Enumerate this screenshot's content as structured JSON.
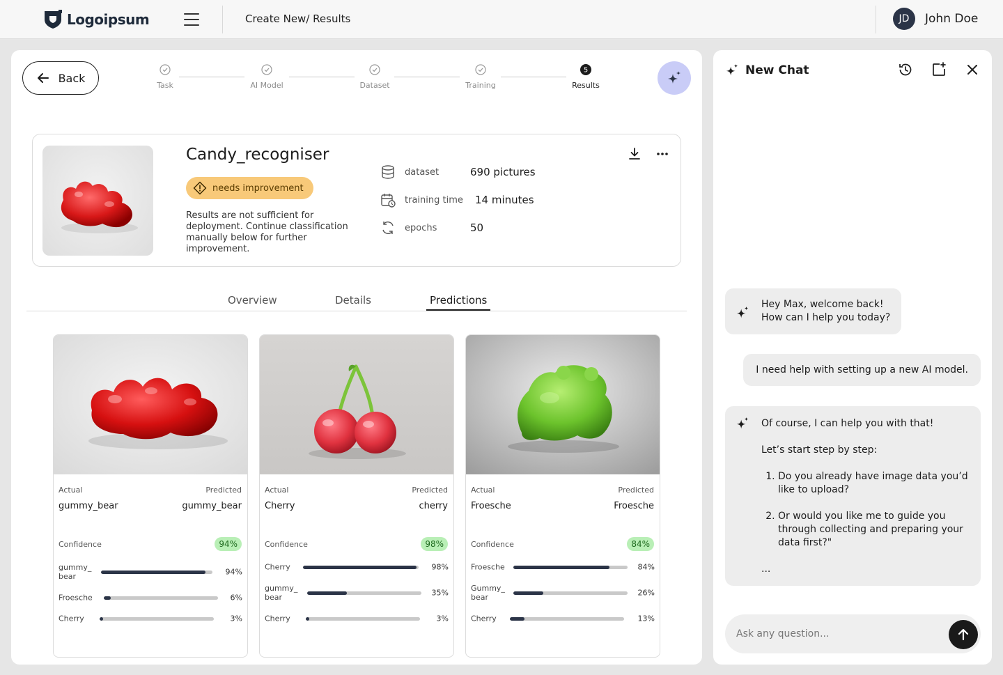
{
  "header": {
    "logo_text": "Logoipsum",
    "breadcrumb": "Create New/ Results",
    "user_initials": "JD",
    "user_name": "John Doe"
  },
  "back_label": "Back",
  "steps": [
    {
      "label": "Task",
      "state": "done"
    },
    {
      "label": "AI Model",
      "state": "done"
    },
    {
      "label": "Dataset",
      "state": "done"
    },
    {
      "label": "Training",
      "state": "done"
    },
    {
      "label": "Results",
      "state": "active",
      "number": "5"
    }
  ],
  "model": {
    "title": "Candy_recogniser",
    "badge": "needs improvement",
    "description": "Results are not sufficient for deployment. Continue classification manually below for further improvement.",
    "meta": [
      {
        "icon": "database-icon",
        "label": "dataset",
        "value": "690 pictures"
      },
      {
        "icon": "calendar-clock-icon",
        "label": "training time",
        "value": "14 minutes"
      },
      {
        "icon": "refresh-cycle-icon",
        "label": "epochs",
        "value": "50"
      }
    ]
  },
  "tabs": [
    "Overview",
    "Details",
    "Predictions"
  ],
  "active_tab": "Predictions",
  "labels": {
    "actual": "Actual",
    "predicted": "Predicted",
    "confidence": "Confidence"
  },
  "predictions": [
    {
      "image": "red gummy bear",
      "actual": "gummy_bear",
      "predicted": "gummy_bear",
      "confidence": "94%",
      "bars": [
        {
          "name": "gummy_ bear",
          "pct": 94,
          "label": "94%"
        },
        {
          "name": "Froesche",
          "pct": 6,
          "label": "6%"
        },
        {
          "name": "Cherry",
          "pct": 3,
          "label": "3%"
        }
      ]
    },
    {
      "image": "sugared cherries",
      "actual": "Cherry",
      "predicted": "cherry",
      "confidence": "98%",
      "bars": [
        {
          "name": "Cherry",
          "pct": 98,
          "label": "98%"
        },
        {
          "name": "gummy_ bear",
          "pct": 35,
          "label": "35%"
        },
        {
          "name": "Cherry",
          "pct": 3,
          "label": "3%"
        }
      ]
    },
    {
      "image": "green gummy frog",
      "actual": "Froesche",
      "predicted": "Froesche",
      "confidence": "84%",
      "bars": [
        {
          "name": "Froesche",
          "pct": 84,
          "label": "84%"
        },
        {
          "name": "Gummy_ bear",
          "pct": 26,
          "label": "26%"
        },
        {
          "name": "Cherry",
          "pct": 13,
          "label": "13%"
        }
      ]
    }
  ],
  "chat": {
    "title": "New Chat",
    "messages": [
      {
        "role": "ai",
        "lines": [
          "Hey Max, welcome back!",
          "How can I help you today?"
        ]
      },
      {
        "role": "user",
        "text": "I need help with setting up a new AI model."
      },
      {
        "role": "ai",
        "intro": "Of course, I can help you with that!",
        "sub": "Let’s start step by step:",
        "items": [
          "Do you already have image data you’d like to upload?",
          "Or would you like me to guide you through collecting and preparing your data first?\""
        ],
        "tail": "..."
      }
    ],
    "input_placeholder": "Ask any question..."
  },
  "colors": {
    "accent_dark": "#2b3447",
    "warning": "#f8c979",
    "success_bg": "#b9efb6",
    "ai_button": "#c9ccf7"
  }
}
